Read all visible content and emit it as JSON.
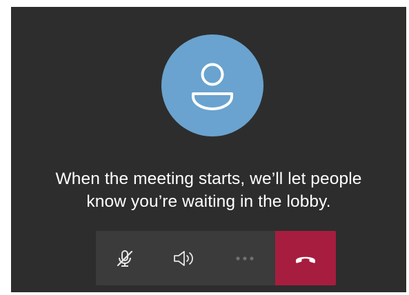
{
  "lobby": {
    "message_line1": "When the meeting starts, we’ll let people",
    "message_line2": "know you’re waiting in the lobby."
  },
  "avatar": {
    "icon": "person-icon",
    "background_color": "#6aa3cf"
  },
  "controls": {
    "mic": {
      "icon": "microphone-off-icon",
      "state": "muted"
    },
    "speaker": {
      "icon": "speaker-icon"
    },
    "more": {
      "icon": "more-options-icon",
      "state": "disabled"
    },
    "hangup": {
      "icon": "hang-up-icon",
      "color": "#a71d3f"
    }
  },
  "colors": {
    "background": "#2d2d2d",
    "control_bar": "#3b3b3b",
    "text": "#ffffff"
  }
}
